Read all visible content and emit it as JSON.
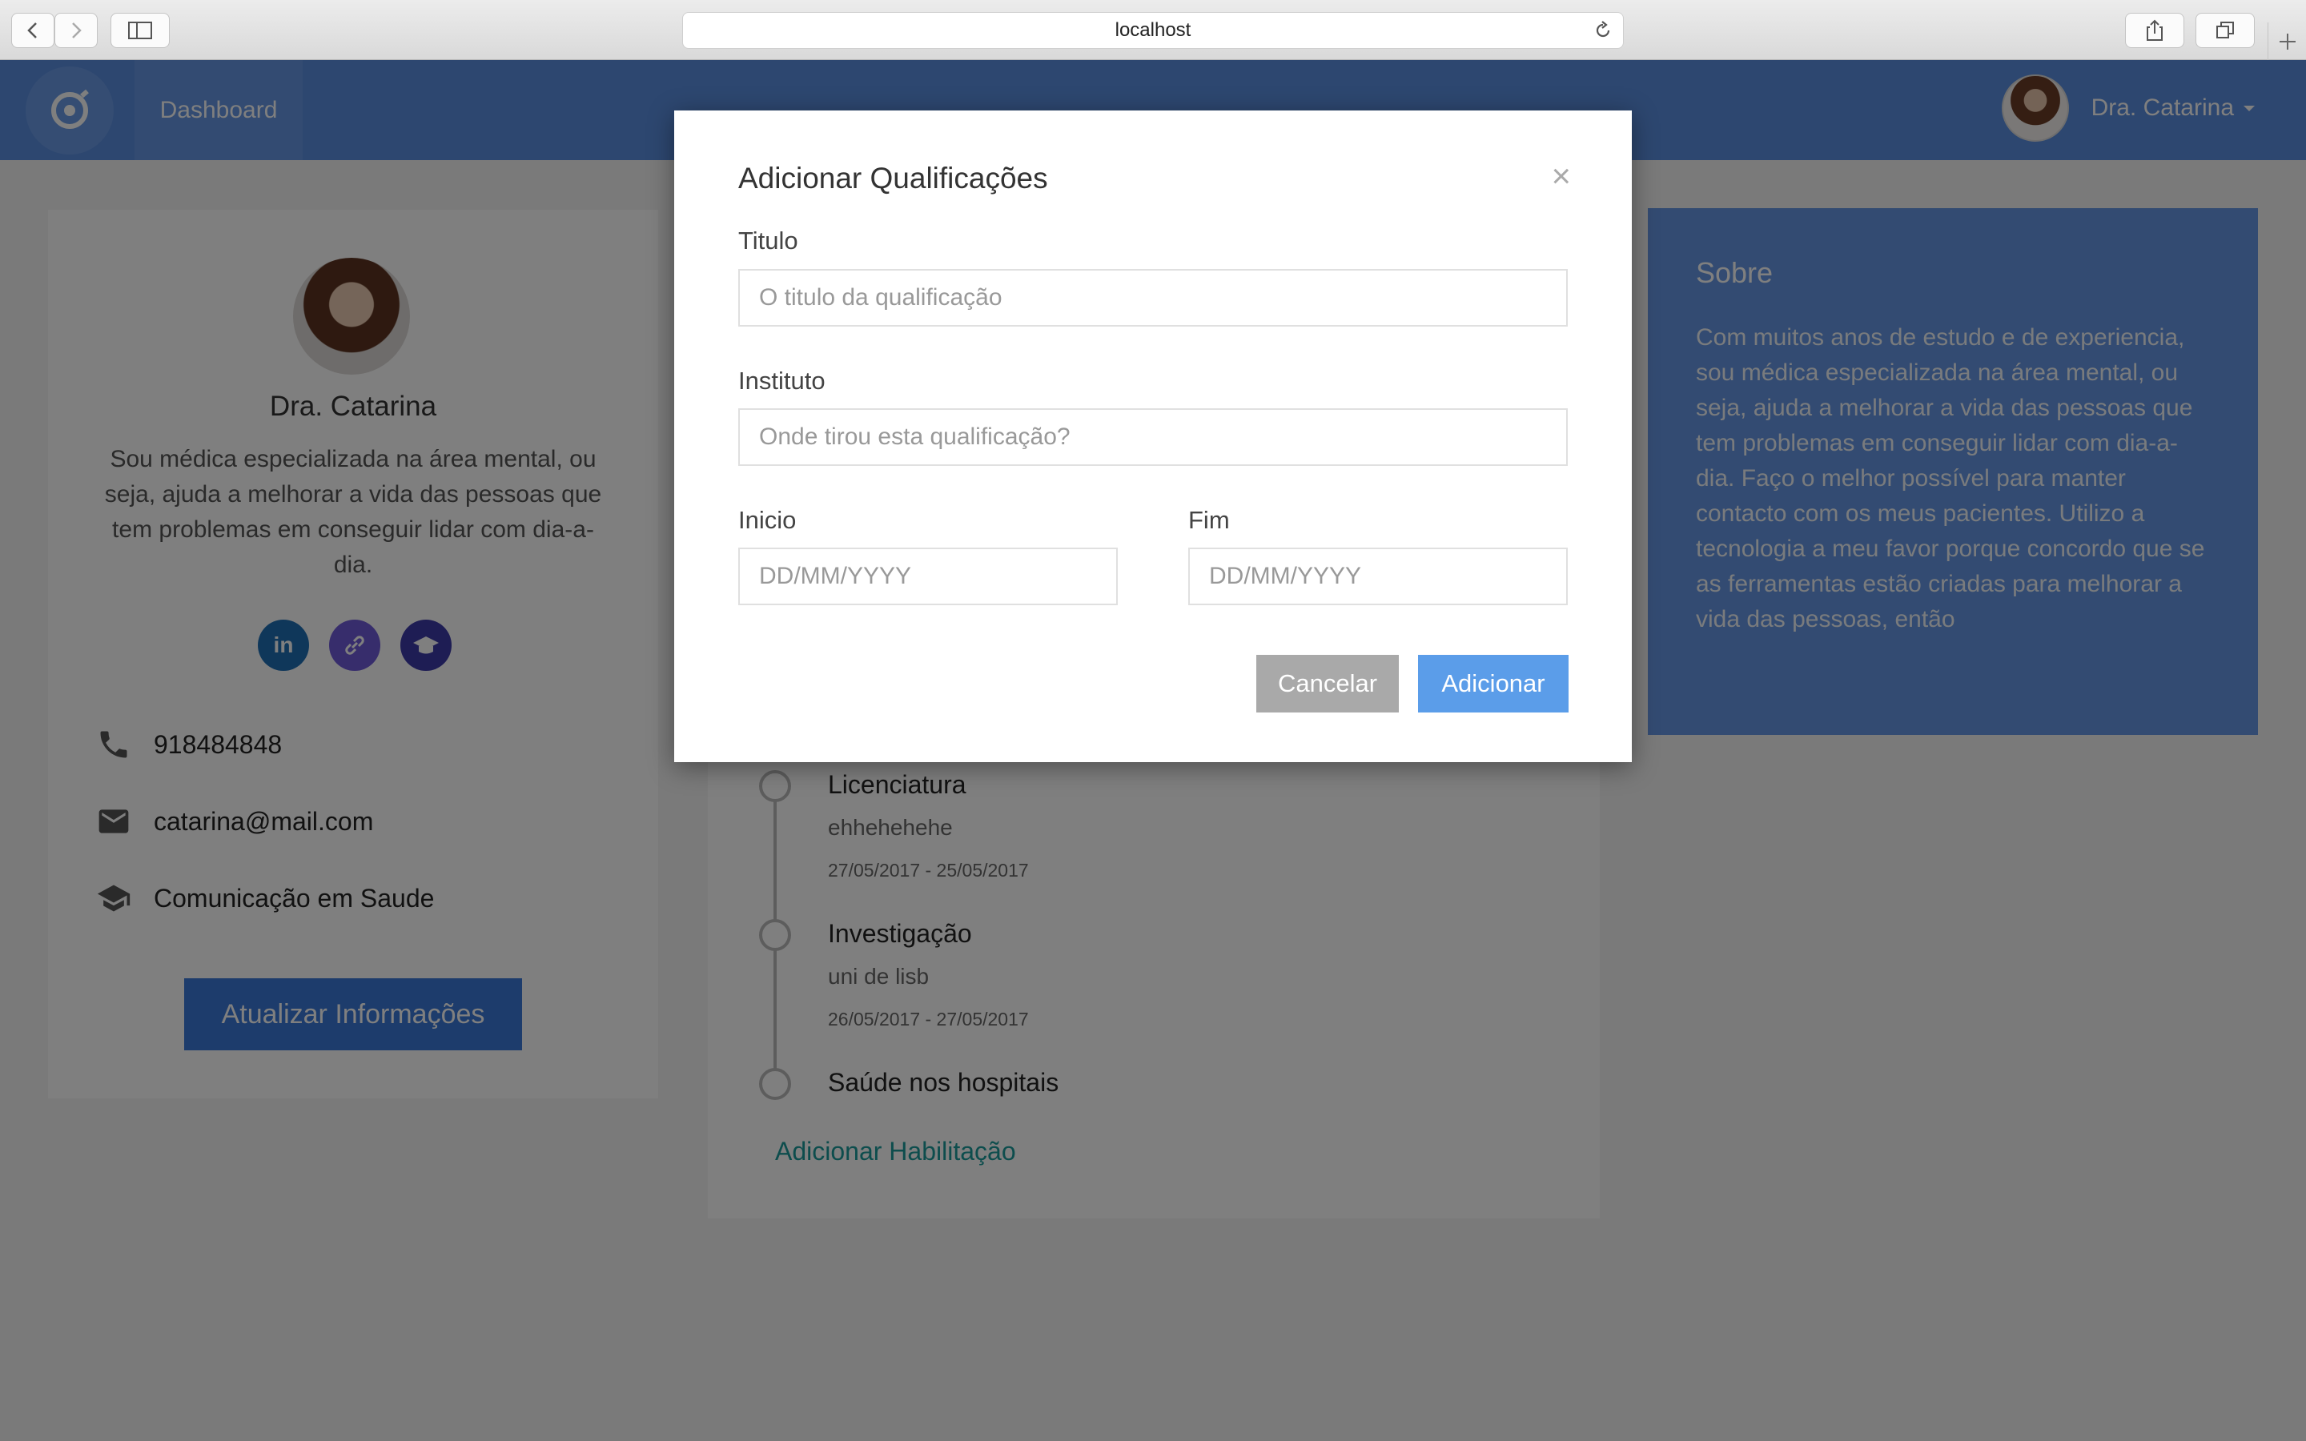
{
  "browser": {
    "url": "localhost",
    "icons": [
      "back-icon",
      "forward-icon",
      "sidebar-icon",
      "reload-icon",
      "share-icon",
      "tabs-icon",
      "new-tab-icon"
    ]
  },
  "navbar": {
    "dashboard_label": "Dashboard",
    "user_name": "Dra. Catarina",
    "color": "#5b8ee0"
  },
  "profile": {
    "name": "Dra. Catarina",
    "bio": "Sou médica especializada na área mental, ou seja, ajuda a melhorar a vida das pessoas que tem problemas em conseguir lidar com dia-a-dia.",
    "socials": [
      {
        "icon": "linkedin-icon",
        "label": "in",
        "color": "#1f6fb5"
      },
      {
        "icon": "link-icon",
        "label": "🔗",
        "color": "#6f5ad8"
      },
      {
        "icon": "graduation-cap-icon",
        "label": "🎓",
        "color": "#3c3aa8"
      }
    ],
    "phone": "918484848",
    "email": "catarina@mail.com",
    "specialty": "Comunicação em Saude",
    "update_button": "Atualizar Informações"
  },
  "timeline": {
    "items": [
      {
        "title": "Licenciatura",
        "institute": "ehhehehehe",
        "dates": "27/05/2017 - 25/05/2017"
      },
      {
        "title": "Investigação",
        "institute": "uni de lisb",
        "dates": "26/05/2017 - 27/05/2017"
      },
      {
        "title": "Saúde nos hospitais"
      }
    ],
    "add_link": "Adicionar Habilitação"
  },
  "about": {
    "title": "Sobre",
    "text": "Com muitos anos de estudo e de experiencia, sou médica especializada na área mental, ou seja, ajuda a melhorar a vida das pessoas que tem problemas em conseguir lidar com dia-a-dia. Faço o melhor possível para manter contacto com os meus pacientes. Utilizo a tecnologia a meu favor porque concordo que se as ferramentas estão criadas para melhorar a vida das pessoas, então"
  },
  "modal": {
    "title": "Adicionar Qualificações",
    "close": "×",
    "titulo_label": "Titulo",
    "titulo_placeholder": "O titulo da qualificação",
    "instituto_label": "Instituto",
    "instituto_placeholder": "Onde tirou esta qualificação?",
    "inicio_label": "Inicio",
    "inicio_placeholder": "DD/MM/YYYY",
    "fim_label": "Fim",
    "fim_placeholder": "DD/MM/YYYY",
    "cancel_button": "Cancelar",
    "add_button": "Adicionar",
    "cancel_color": "#a9a9a9",
    "add_color": "#5b9de9"
  }
}
